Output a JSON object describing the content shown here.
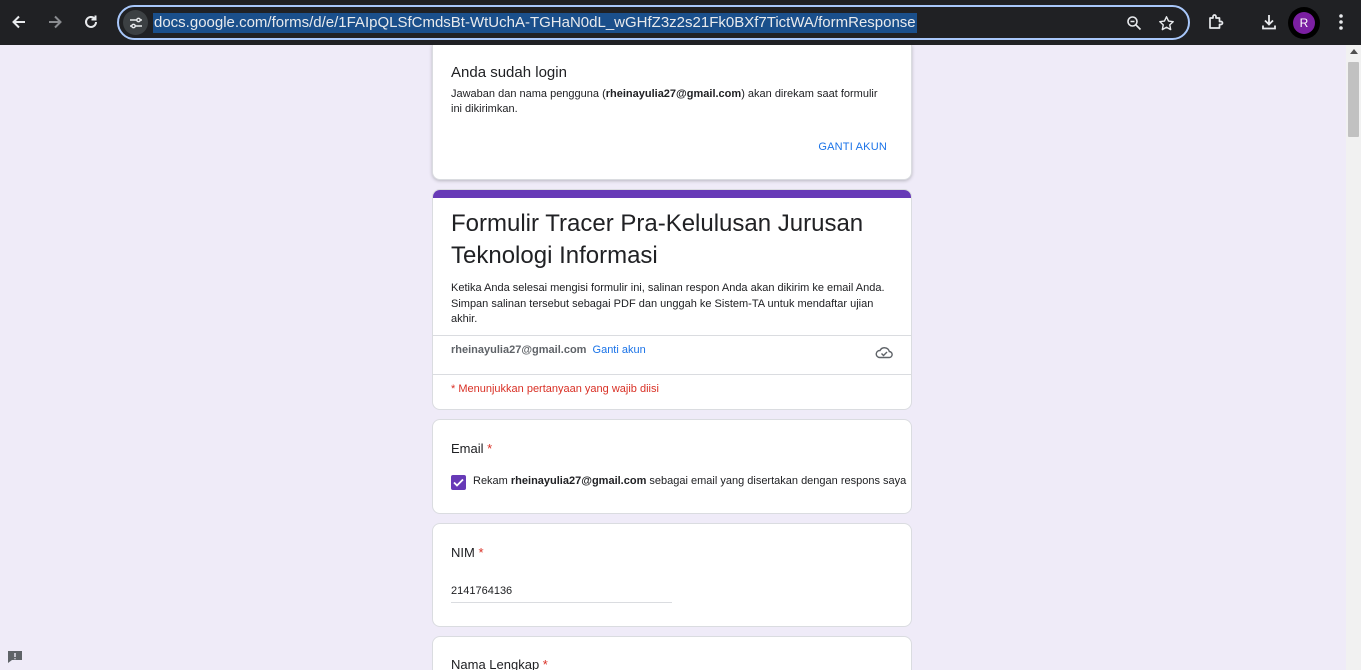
{
  "browser": {
    "url": "docs.google.com/forms/d/e/1FAIpQLSfCmdsBt-WtUchA-TGHaN0dL_wGHfZ3z2s21Fk0BXf7TictWA/formResponse",
    "profile_initial": "R"
  },
  "login_card": {
    "title": "Anda sudah login",
    "desc_prefix": "Jawaban dan nama pengguna (",
    "desc_email": "rheinayulia27@gmail.com",
    "desc_suffix": ") akan direkam saat formulir ini dikirimkan.",
    "switch_button": "GANTI AKUN"
  },
  "form": {
    "title": "Formulir Tracer Pra-Kelulusan Jurusan Teknologi Informasi",
    "description": "Ketika Anda selesai mengisi formulir ini, salinan respon Anda akan dikirim ke email Anda. Simpan salinan tersebut sebagai PDF dan unggah ke Sistem-TA untuk mendaftar ujian akhir.",
    "account_email": "rheinayulia27@gmail.com",
    "switch_account_link": "Ganti akun",
    "required_note": "* Menunjukkan pertanyaan yang wajib diisi",
    "accent_color": "#673ab7"
  },
  "questions": {
    "email": {
      "label": "Email",
      "required_mark": "*",
      "checkbox_checked": true,
      "checkbox_prefix": "Rekam ",
      "checkbox_email": "rheinayulia27@gmail.com",
      "checkbox_suffix": " sebagai email yang disertakan dengan respons saya"
    },
    "nim": {
      "label": "NIM",
      "required_mark": "*",
      "value": "2141764136"
    },
    "nama": {
      "label": "Nama Lengkap",
      "required_mark": "*"
    }
  }
}
